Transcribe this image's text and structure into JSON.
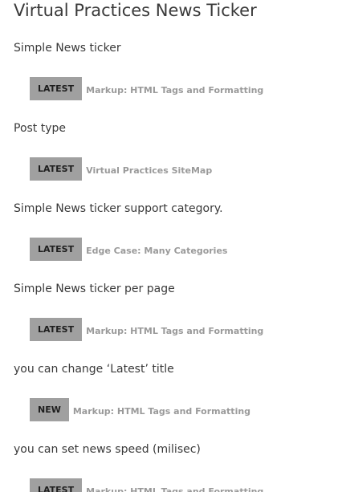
{
  "page": {
    "title": "Virtual Practices News Ticker"
  },
  "sections": [
    {
      "description": "Simple News ticker",
      "ticker": {
        "badge": "LATEST",
        "link": "Markup: HTML Tags and Formatting"
      }
    },
    {
      "description": "Post type",
      "ticker": {
        "badge": "LATEST",
        "link": "Virtual Practices SiteMap"
      }
    },
    {
      "description": "Simple News ticker support category.",
      "ticker": {
        "badge": "LATEST",
        "link": "Edge Case: Many Categories"
      }
    },
    {
      "description": "Simple News ticker per page",
      "ticker": {
        "badge": "LATEST",
        "link": "Markup: HTML Tags and Formatting"
      }
    },
    {
      "description": "you can change ‘Latest’ title",
      "ticker": {
        "badge": "NEW",
        "link": "Markup: HTML Tags and Formatting"
      }
    },
    {
      "description": "you can set news speed (milisec)",
      "ticker": {
        "badge": "LATEST",
        "link": "Markup: HTML Tags and Formatting"
      }
    }
  ],
  "colors": {
    "badge_bg": "#a0a0a0",
    "badge_text": "#1e1e1e",
    "link_text": "#9a9a9a",
    "body_text": "#3a3a3a"
  }
}
